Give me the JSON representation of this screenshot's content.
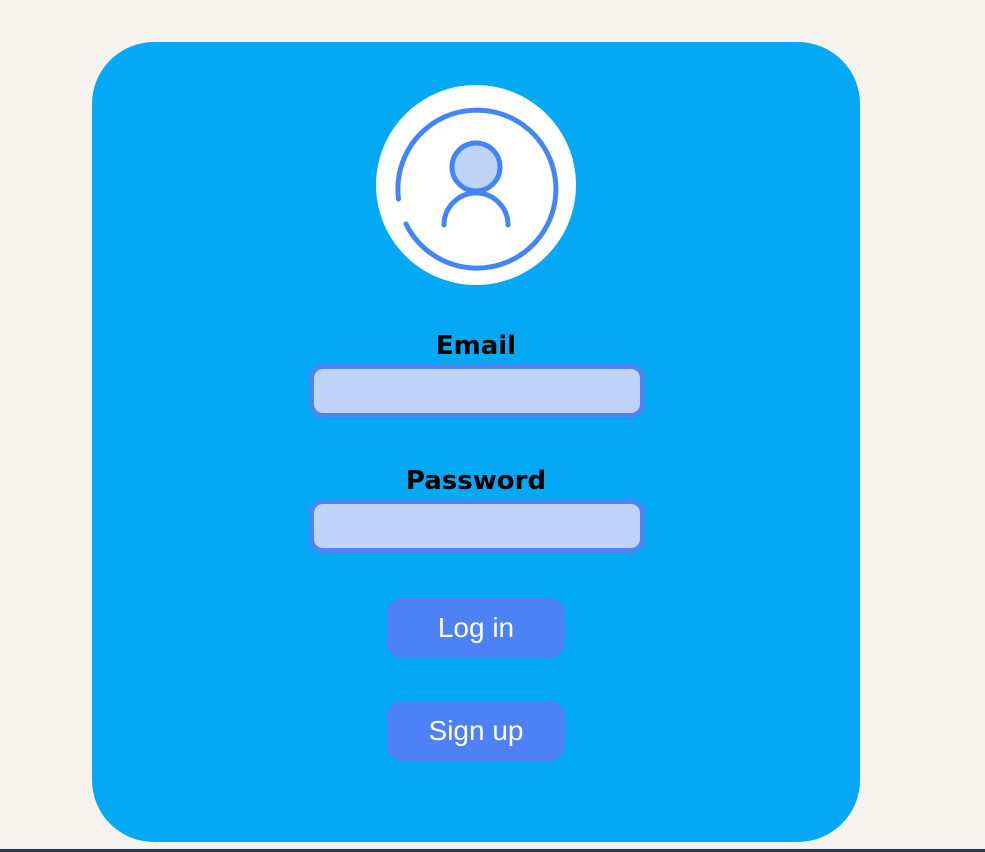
{
  "login_form": {
    "email_label": "Email",
    "email_value": "",
    "password_label": "Password",
    "password_value": "",
    "login_label": "Log in",
    "signup_label": "Sign up"
  },
  "avatar": {
    "icon": "user-circle-icon"
  },
  "colors": {
    "page_background": "#f6f3ee",
    "card_background": "#04a9f5",
    "input_fill": "#bed3f7",
    "input_border": "#4d86f2",
    "button_fill": "#4d81f5",
    "icon_stroke": "#4285f4"
  }
}
